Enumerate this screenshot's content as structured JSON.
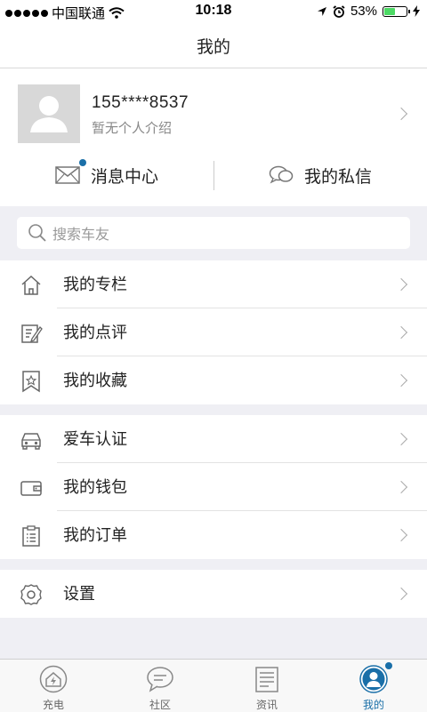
{
  "status": {
    "carrier": "中国联通",
    "time": "10:18",
    "battery": "53%",
    "battery_level": 0.53
  },
  "header": {
    "title": "我的"
  },
  "profile": {
    "phone": "155****8537",
    "intro": "暂无个人介绍"
  },
  "messages": {
    "center_label": "消息中心",
    "private_label": "我的私信"
  },
  "search": {
    "placeholder": "搜索车友"
  },
  "menu_group1": [
    {
      "label": "我的专栏",
      "icon": "home-icon"
    },
    {
      "label": "我的点评",
      "icon": "edit-icon"
    },
    {
      "label": "我的收藏",
      "icon": "bookmark-star-icon"
    }
  ],
  "menu_group2": [
    {
      "label": "爱车认证",
      "icon": "car-icon"
    },
    {
      "label": "我的钱包",
      "icon": "wallet-icon"
    },
    {
      "label": "我的订单",
      "icon": "clipboard-icon"
    }
  ],
  "menu_group3": [
    {
      "label": "设置",
      "icon": "gear-icon"
    }
  ],
  "tabs": [
    {
      "label": "充电",
      "icon": "charge-home-icon"
    },
    {
      "label": "社区",
      "icon": "chat-bubble-icon"
    },
    {
      "label": "资讯",
      "icon": "news-icon"
    },
    {
      "label": "我的",
      "icon": "profile-icon"
    }
  ],
  "colors": {
    "accent": "#1a6fa8",
    "background": "#efeff4"
  }
}
